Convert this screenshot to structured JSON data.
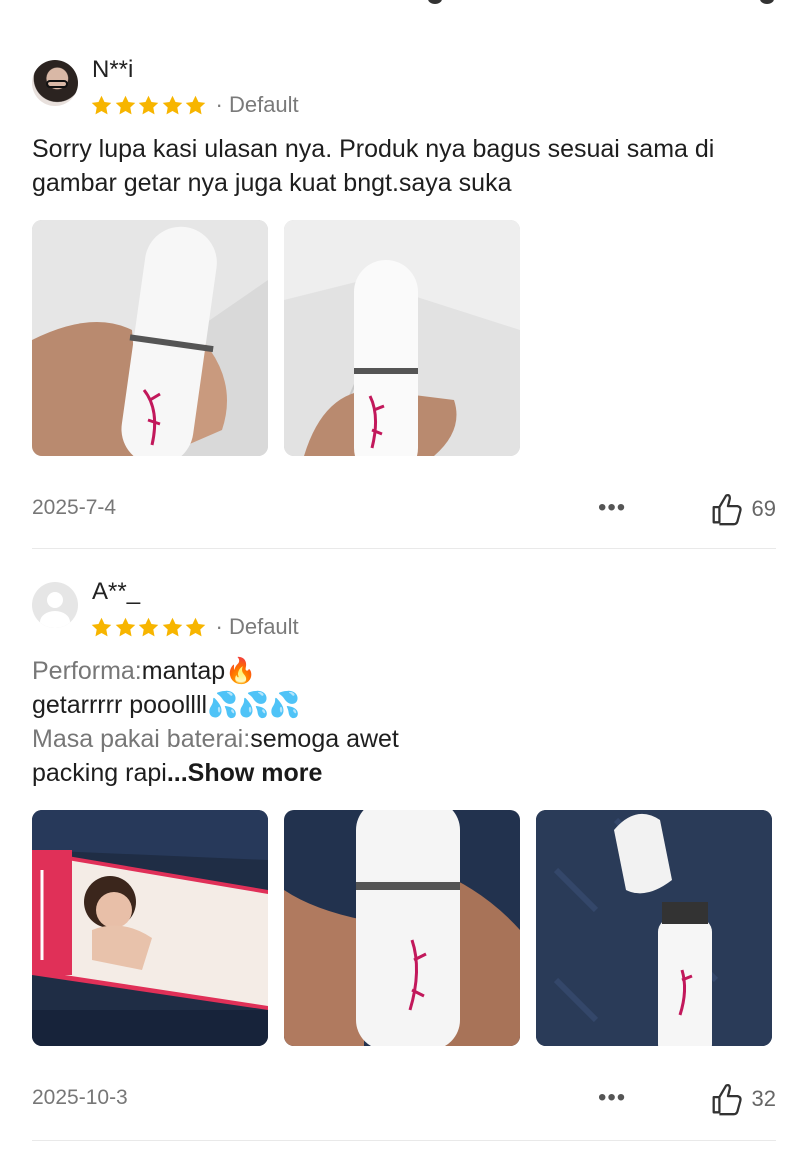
{
  "reviews": [
    {
      "username": "N**i",
      "rating": 5,
      "variant": "Default",
      "text": "Sorry lupa kasi ulasan nya. Produk nya bagus sesuai sama di gambar getar nya juga kuat bngt.saya suka",
      "photo_count": 2,
      "date": "2025-7-4",
      "likes": "69"
    },
    {
      "username": "A**_",
      "rating": 5,
      "variant": "Default",
      "lines": [
        {
          "label": "Performa:",
          "value": "mantap",
          "emoji": "🔥"
        },
        {
          "label": "",
          "value": "getarrrrr pooollll",
          "emoji": "💦💦💦"
        },
        {
          "label": "Masa pakai baterai:",
          "value": "semoga awet",
          "emoji": ""
        },
        {
          "label": "",
          "value": "packing rapi",
          "emoji": ""
        }
      ],
      "show_more": "...Show more",
      "photo_count": 3,
      "date": "2025-10-3",
      "likes": "32"
    }
  ],
  "icons": {
    "star": "star-icon",
    "more": "more-dots-icon",
    "like": "thumbs-up-icon"
  },
  "colors": {
    "star": "#F7B500",
    "secondary_text": "#777777",
    "divider": "#E9E9E9"
  }
}
